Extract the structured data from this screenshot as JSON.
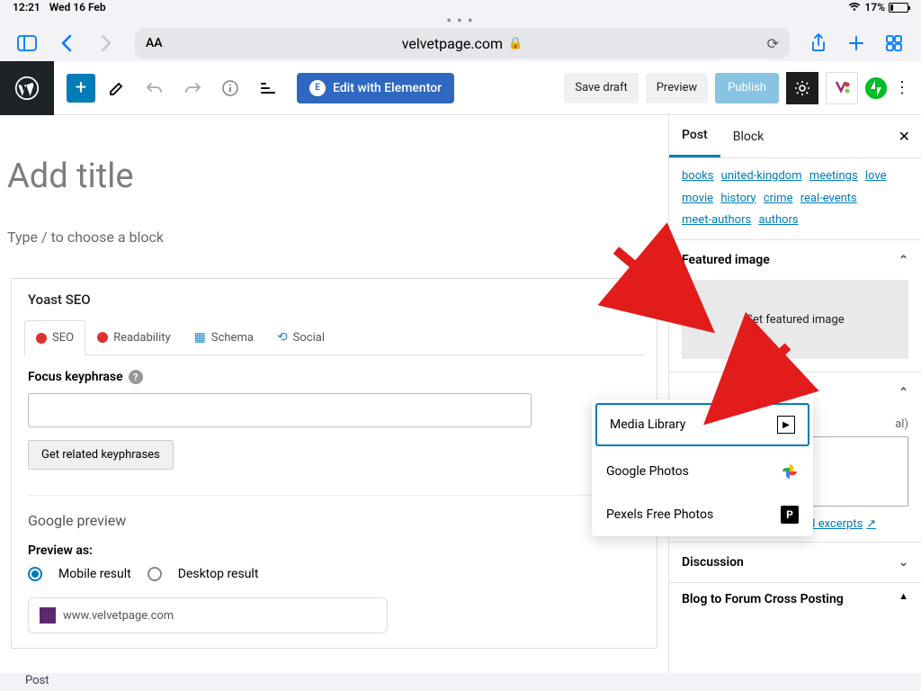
{
  "status": {
    "time": "12:21",
    "date": "Wed 16 Feb",
    "battery_pct": "17%"
  },
  "safari": {
    "url": "velvetpage.com"
  },
  "wp_top": {
    "elementor_label": "Edit with Elementor",
    "save_draft": "Save draft",
    "preview": "Preview",
    "publish": "Publish"
  },
  "editor": {
    "title_placeholder": "Add title",
    "block_prompt": "Type / to choose a block"
  },
  "yoast": {
    "panel_title": "Yoast SEO",
    "tabs": {
      "seo": "SEO",
      "readability": "Readability",
      "schema": "Schema",
      "social": "Social"
    },
    "focus_label": "Focus keyphrase",
    "get_related": "Get related keyphrases",
    "google_preview": "Google preview",
    "preview_as": "Preview as:",
    "mobile_result": "Mobile result",
    "desktop_result": "Desktop result",
    "preview_url": "www.velvetpage.com"
  },
  "sidebar": {
    "tabs": {
      "post": "Post",
      "block": "Block"
    },
    "tags": [
      "books",
      "united-kingdom",
      "meetings",
      "love",
      "movie",
      "history",
      "crime",
      "real-events",
      "meet-authors",
      "authors"
    ],
    "featured_heading": "Featured image",
    "set_featured": "Set featured image",
    "excerpt_hint": "al)",
    "learn_more": "Learn more about manual excerpts",
    "discussion": "Discussion",
    "blog_forum": "Blog to Forum Cross Posting"
  },
  "media_menu": {
    "item1": "Media Library",
    "item2": "Google Photos",
    "item3": "Pexels Free Photos"
  },
  "bottom_label": "Post"
}
